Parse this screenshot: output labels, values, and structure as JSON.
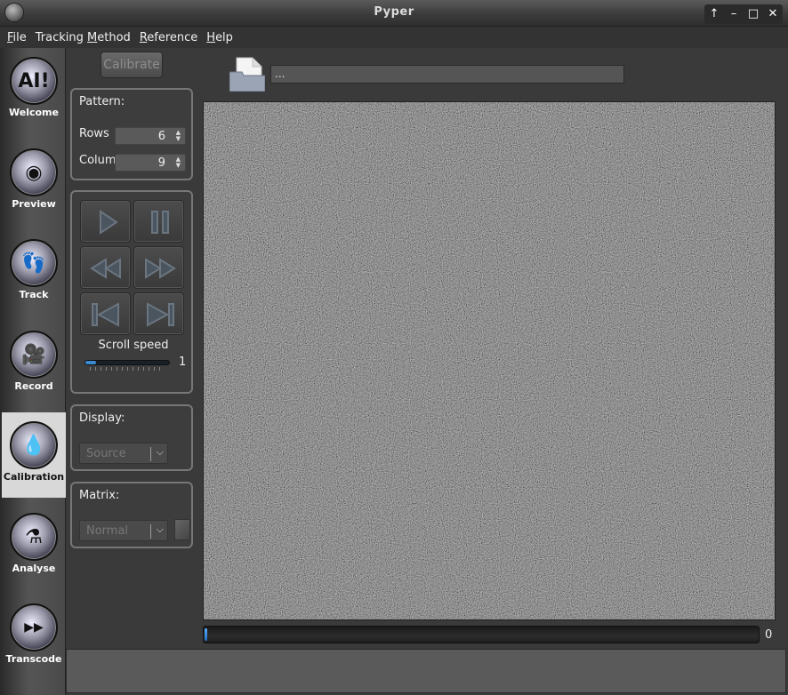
{
  "window": {
    "title": "Pyper"
  },
  "window_buttons": [
    "↑",
    "–",
    "□",
    "✕"
  ],
  "menu": [
    {
      "mnemonic": "F",
      "rest": "ile"
    },
    {
      "mnemonic": "",
      "lead": "Tracking ",
      "mid": "M",
      "rest": "ethod"
    },
    {
      "mnemonic": "R",
      "rest": "eference"
    },
    {
      "mnemonic": "H",
      "rest": "elp"
    }
  ],
  "nav": [
    {
      "label": "Welcome",
      "icon": "welcome-icon",
      "glyph": "AI!"
    },
    {
      "label": "Preview",
      "icon": "eye-icon",
      "glyph": "◉"
    },
    {
      "label": "Track",
      "icon": "footprints-icon",
      "glyph": "👣"
    },
    {
      "label": "Record",
      "icon": "camera-icon",
      "glyph": "🎥"
    },
    {
      "label": "Calibration",
      "icon": "drop-icon",
      "glyph": "💧",
      "active": true
    },
    {
      "label": "Analyse",
      "icon": "analyse-icon",
      "glyph": "⚗"
    },
    {
      "label": "Transcode",
      "icon": "transcode-icon",
      "glyph": "▶▶"
    }
  ],
  "calibrate_button": "Calibrate",
  "pattern": {
    "title": "Pattern:",
    "rows_label": "Rows",
    "rows_value": "6",
    "columns_label": "Colum",
    "columns_value": "9"
  },
  "player": {
    "scroll_speed_label": "Scroll speed",
    "scroll_speed_value": "1",
    "scroll_speed_fraction": 0.12
  },
  "display": {
    "title": "Display:",
    "value": "Source"
  },
  "matrix": {
    "title": "Matrix:",
    "value": "Normal"
  },
  "path": {
    "value": "..."
  },
  "progress": {
    "value": "0",
    "fraction": 0.005
  }
}
